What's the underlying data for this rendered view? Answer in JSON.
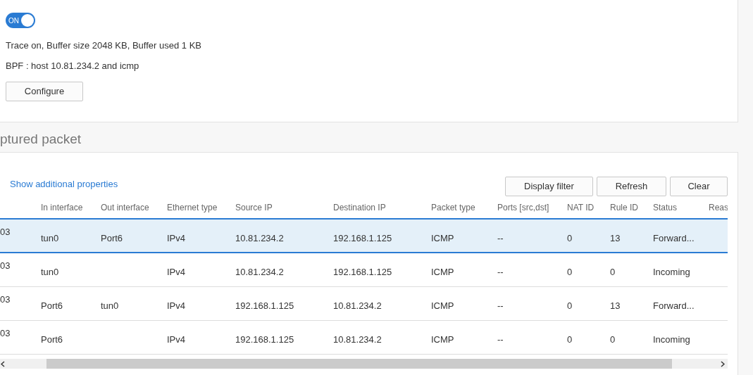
{
  "trace": {
    "toggle": {
      "label": "ON",
      "on": true
    },
    "status": "Trace on, Buffer size 2048 KB, Buffer used 1 KB",
    "bpf": "BPF : host 10.81.234.2 and icmp",
    "configure_button": "Configure"
  },
  "section_title": "ptured packet",
  "packets": {
    "link": "Show additional properties",
    "buttons": [
      "Display filter",
      "Refresh",
      "Clear"
    ],
    "columns": [
      "",
      "In interface",
      "Out interface",
      "Ethernet type",
      "Source IP",
      "Destination IP",
      "Packet type",
      "Ports [src,dst]",
      "NAT ID",
      "Rule ID",
      "Status",
      "Reas"
    ],
    "rows": [
      {
        "selected": true,
        "cells": [
          "03",
          "tun0",
          "Port6",
          "IPv4",
          "10.81.234.2",
          "192.168.1.125",
          "ICMP",
          "--",
          "0",
          "13",
          "Forward...",
          ""
        ]
      },
      {
        "selected": false,
        "cells": [
          "03",
          "tun0",
          "",
          "IPv4",
          "10.81.234.2",
          "192.168.1.125",
          "ICMP",
          "--",
          "0",
          "0",
          "Incoming",
          ""
        ]
      },
      {
        "selected": false,
        "cells": [
          "03",
          "Port6",
          "tun0",
          "IPv4",
          "192.168.1.125",
          "10.81.234.2",
          "ICMP",
          "--",
          "0",
          "13",
          "Forward...",
          ""
        ]
      },
      {
        "selected": false,
        "cells": [
          "03",
          "Port6",
          "",
          "IPv4",
          "192.168.1.125",
          "10.81.234.2",
          "ICMP",
          "--",
          "0",
          "0",
          "Incoming",
          ""
        ]
      }
    ]
  }
}
